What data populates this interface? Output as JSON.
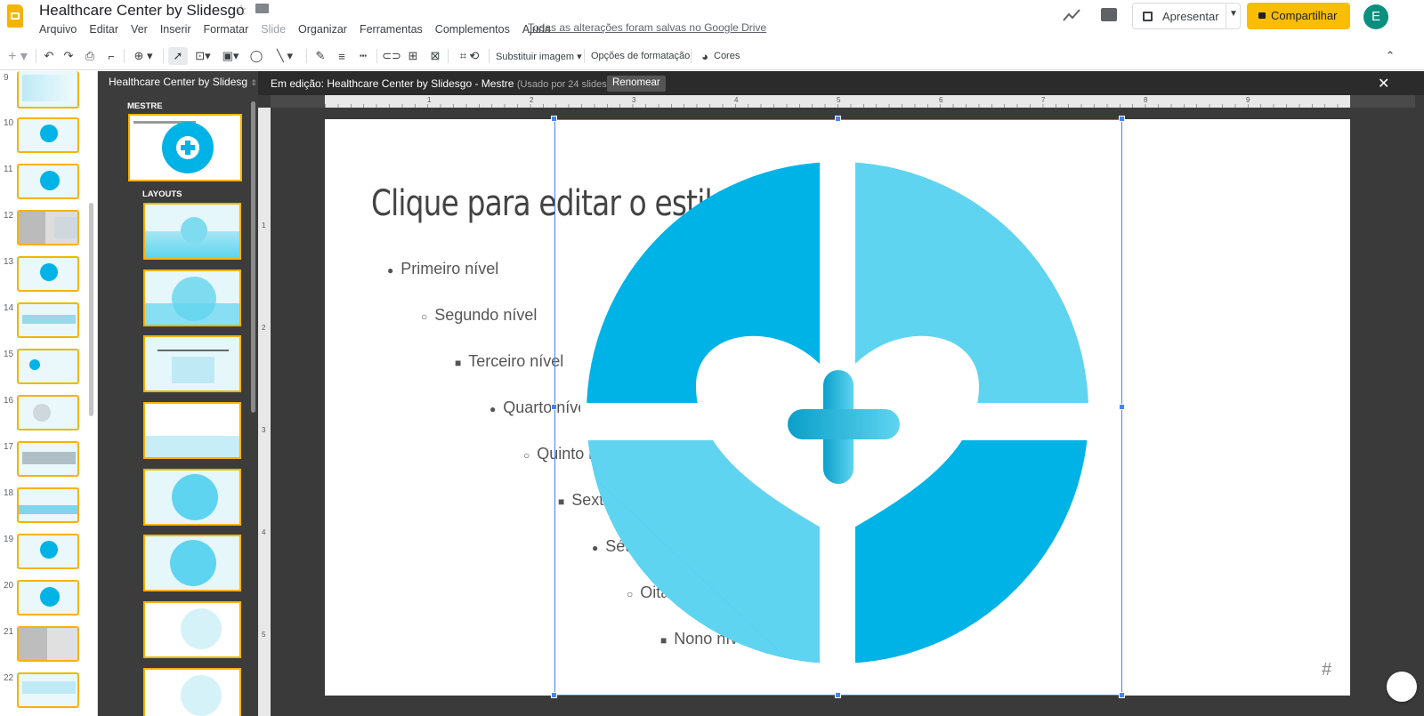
{
  "app": {
    "doc_title": "Healthcare Center by Slidesgo",
    "menus": [
      "Arquivo",
      "Editar",
      "Ver",
      "Inserir",
      "Formatar",
      "Slide",
      "Organizar",
      "Ferramentas",
      "Complementos",
      "Ajuda"
    ],
    "save_status": "Todas as alterações foram salvas no Google Drive",
    "present_label": "Apresentar",
    "share_label": "Compartilhar",
    "avatar_letter": "E"
  },
  "toolbar": {
    "replace_image": "Substituir imagem",
    "format_options": "Opções de formatação",
    "colors": "Cores"
  },
  "filmstrip": {
    "numbers": [
      "9",
      "10",
      "11",
      "12",
      "13",
      "14",
      "15",
      "16",
      "17",
      "18",
      "19",
      "20",
      "21",
      "22"
    ]
  },
  "master_panel": {
    "theme_name": "Healthcare Center by Slidesg",
    "master_heading": "MESTRE",
    "layouts_heading": "LAYOUTS"
  },
  "editor": {
    "editing_label": "Em edição: Healthcare Center by Slidesgo - Mestre",
    "used_by": "(Usado por 24 slides)",
    "rename_label": "Renomear",
    "ruler_numbers": [
      "1",
      "2",
      "3",
      "4",
      "5",
      "6",
      "7",
      "8",
      "9"
    ],
    "vruler_numbers": [
      "1",
      "2",
      "3",
      "4",
      "5"
    ]
  },
  "slide": {
    "title": "Clique para editar o estilo do título mestre",
    "bullets": [
      {
        "text": "Primeiro nível",
        "bullet": "●"
      },
      {
        "text": "Segundo nível",
        "bullet": "○"
      },
      {
        "text": "Terceiro nível",
        "bullet": "■"
      },
      {
        "text": "Quarto nível",
        "bullet": "●"
      },
      {
        "text": "Quinto nível",
        "bullet": "○"
      },
      {
        "text": "Sexto nível",
        "bullet": "■"
      },
      {
        "text": "Sétimo nível",
        "bullet": "●"
      },
      {
        "text": "Oitavo nível",
        "bullet": "○"
      },
      {
        "text": "Nono nível",
        "bullet": "■"
      }
    ],
    "page_number": "#"
  },
  "colors": {
    "accent_dark": "#00b3e6",
    "accent_light": "#5fd4f0",
    "share_yellow": "#fbbc04",
    "avatar": "#0a8f7e"
  }
}
